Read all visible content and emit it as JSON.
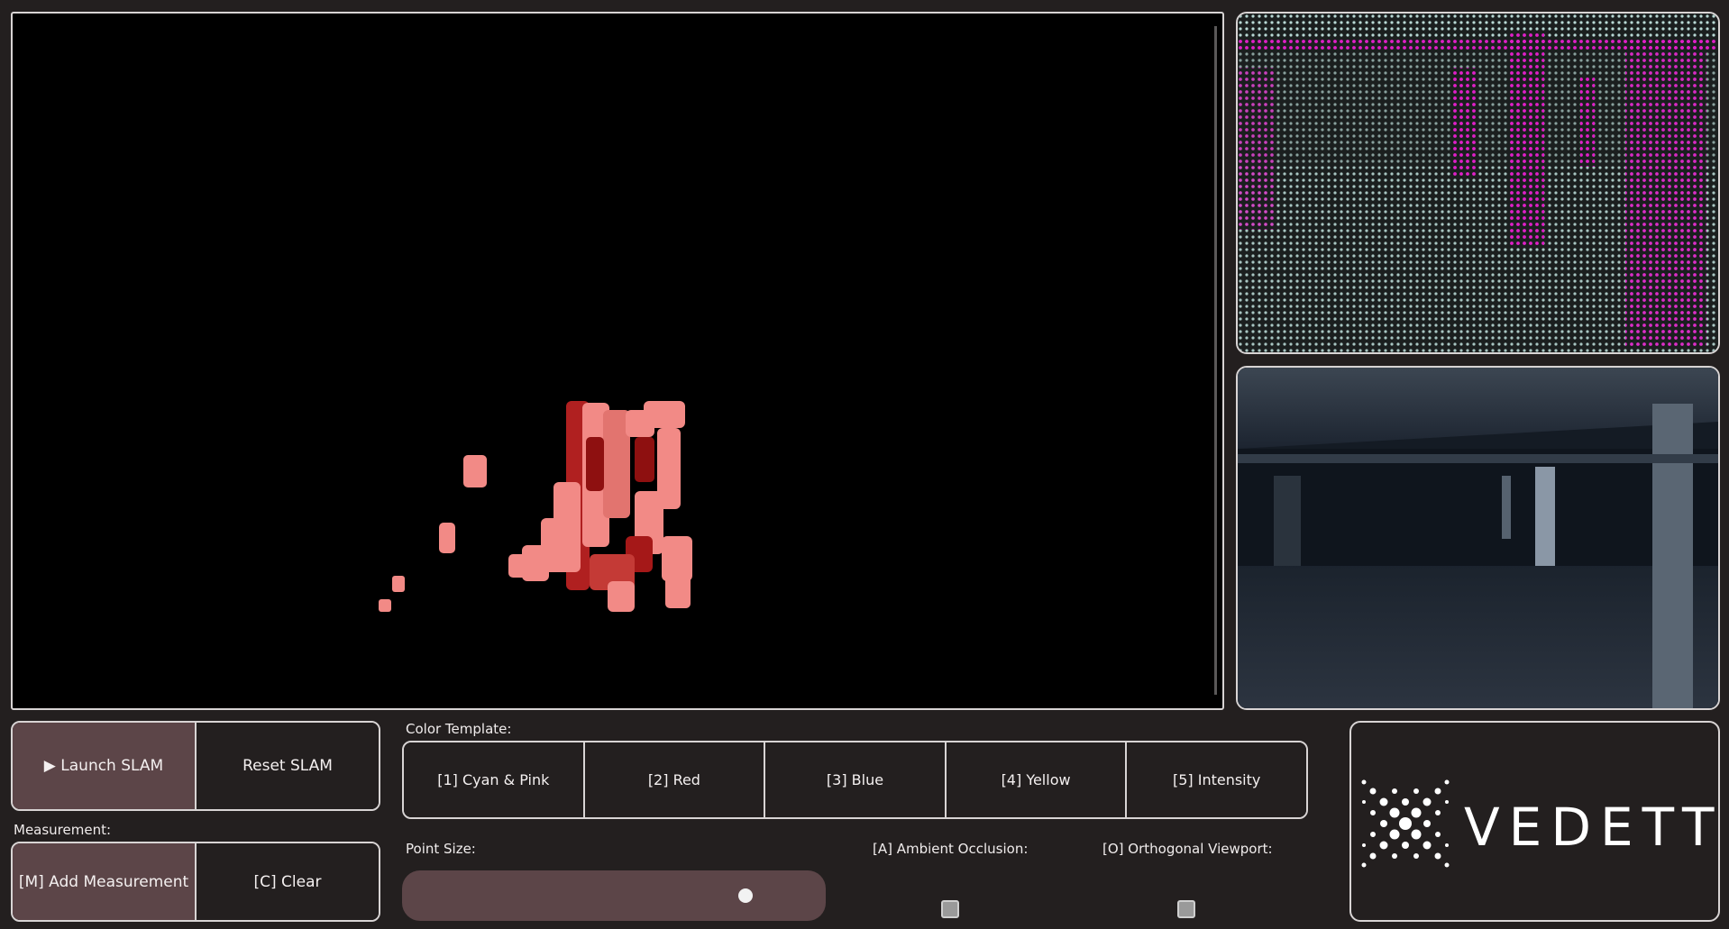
{
  "slam": {
    "launch_label": "▶ Launch SLAM",
    "reset_label": "Reset SLAM"
  },
  "measurement": {
    "heading": "Measurement:",
    "add_label": "[M] Add Measurement",
    "clear_label": "[C] Clear"
  },
  "color_template": {
    "heading": "Color Template:",
    "options": [
      "[1] Cyan & Pink",
      "[2] Red",
      "[3] Blue",
      "[4] Yellow",
      "[5] Intensity"
    ],
    "selected_index": null
  },
  "point_size": {
    "heading": "Point Size:",
    "value_fraction": 0.85
  },
  "toggles": {
    "ambient_occlusion_label": "[A] Ambient Occlusion:",
    "ambient_occlusion_checked": false,
    "orthogonal_viewport_label": "[O] Orthogonal Viewport:",
    "orthogonal_viewport_checked": false
  },
  "brand": {
    "logo_text": "VEDETTE"
  },
  "colors": {
    "background": "#231f1f",
    "active_button": "#5c4548",
    "border": "#d8d4d4",
    "pointcloud_salmon": "#f28a86",
    "pointcloud_dark_red": "#9e1414",
    "preview_cyan": "#b8d8d4",
    "preview_pink": "#e01ec8"
  },
  "views": {
    "main": "3d-point-cloud-viewport",
    "top_right": "point-cloud-preview",
    "bottom_right": "camera-feed"
  }
}
